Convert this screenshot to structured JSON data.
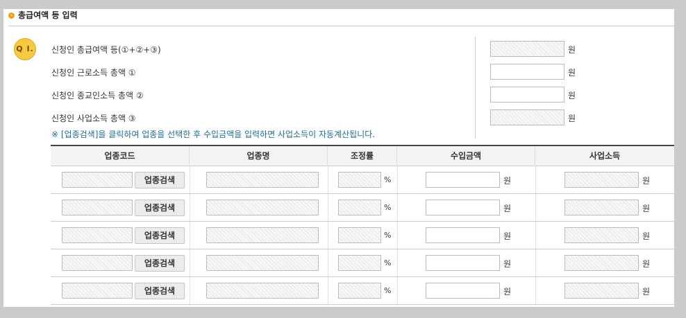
{
  "section": {
    "title": "총급여액 등 입력",
    "bullet_icon": "arrow-circle-icon"
  },
  "question": {
    "badge": "Q I."
  },
  "fields": [
    {
      "label": "신청인 총급여액 등(①+②+③)",
      "value": "",
      "unit": "원",
      "readonly": true
    },
    {
      "label": "신청인 근로소득 총액 ①",
      "value": "",
      "unit": "원",
      "readonly": false
    },
    {
      "label": "신청인 종교인소득 총액 ②",
      "value": "",
      "unit": "원",
      "readonly": false
    },
    {
      "label": "신청인 사업소득 총액 ③",
      "value": "",
      "unit": "원",
      "readonly": true
    }
  ],
  "note": "※ [업종검색]을 클릭하여 업종을 선택한 후 수입금액을 입력하면 사업소득이 자동계산됩니다.",
  "table": {
    "headers": [
      "업종코드",
      "업종명",
      "조정률",
      "수입금액",
      "사업소득"
    ],
    "rows": [
      {
        "code": "",
        "search_label": "업종검색",
        "name": "",
        "rate": "",
        "rate_unit": "%",
        "income": "",
        "income_unit": "원",
        "business_income": "",
        "business_unit": "원"
      },
      {
        "code": "",
        "search_label": "업종검색",
        "name": "",
        "rate": "",
        "rate_unit": "%",
        "income": "",
        "income_unit": "원",
        "business_income": "",
        "business_unit": "원"
      },
      {
        "code": "",
        "search_label": "업종검색",
        "name": "",
        "rate": "",
        "rate_unit": "%",
        "income": "",
        "income_unit": "원",
        "business_income": "",
        "business_unit": "원"
      },
      {
        "code": "",
        "search_label": "업종검색",
        "name": "",
        "rate": "",
        "rate_unit": "%",
        "income": "",
        "income_unit": "원",
        "business_income": "",
        "business_unit": "원"
      },
      {
        "code": "",
        "search_label": "업종검색",
        "name": "",
        "rate": "",
        "rate_unit": "%",
        "income": "",
        "income_unit": "원",
        "business_income": "",
        "business_unit": "원"
      }
    ]
  }
}
